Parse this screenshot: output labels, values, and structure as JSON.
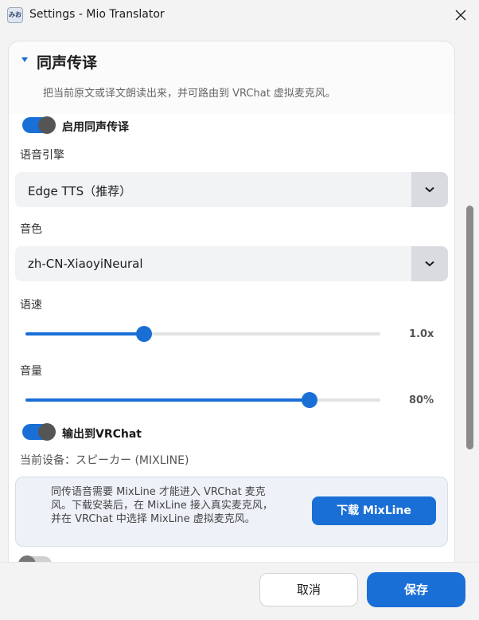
{
  "window": {
    "title": "Settings - Mio Translator",
    "app_icon_text": "みお",
    "accent": "#1a6fd6"
  },
  "section": {
    "title": "同声传译",
    "description": "把当前原文或译文朗读出来，并可路由到 VRChat 虚拟麦克风。"
  },
  "enable_toggle": {
    "label": "启用同声传译",
    "on": true
  },
  "engine": {
    "label": "语音引擎",
    "value": "Edge TTS（推荐）"
  },
  "voice": {
    "label": "音色",
    "value": "zh-CN-XiaoyiNeural"
  },
  "speed": {
    "label": "语速",
    "value_text": "1.0x",
    "fraction": 0.335
  },
  "volume": {
    "label": "音量",
    "value_text": "80%",
    "fraction": 0.8
  },
  "vrchat_toggle": {
    "label": "输出到VRChat",
    "on": true
  },
  "device": {
    "text": "当前设备：スピーカー (MIXLINE)"
  },
  "notice": {
    "text": "同传语音需要 MixLine 才能进入 VRChat 麦克风。下载安装后，在 MixLine 接入真实麦克风，并在 VRChat 中选择 MixLine 虚拟麦克风。",
    "button": "下载 MixLine"
  },
  "footer": {
    "cancel": "取消",
    "save": "保存"
  },
  "icons": {
    "close": "close-icon",
    "collapse": "chevron-down-icon",
    "dropdown": "chevron-down-icon"
  }
}
